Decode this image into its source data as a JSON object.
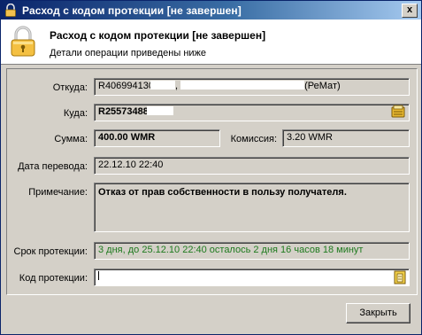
{
  "window": {
    "title": "Расход с кодом протекции [не завершен]",
    "close_glyph": "x"
  },
  "header": {
    "title": "Расход с кодом протекции [не завершен]",
    "subtitle": "Детали операции приведены ниже"
  },
  "form": {
    "from_label": "Откуда:",
    "from_purse": "R406994130",
    "from_sep": ",",
    "from_suffix": "(РеМат)",
    "to_label": "Куда:",
    "to_purse": "R25573488",
    "amount_label": "Сумма:",
    "amount_value": "400.00 WMR",
    "fee_label": "Комиссия:",
    "fee_value": "3.20 WMR",
    "date_label": "Дата перевода:",
    "date_value": "22.12.10 22:40",
    "note_label": "Примечание:",
    "note_value": "Отказ от прав собственности в пользу получателя.",
    "protection_term_label": "Срок протекции:",
    "protection_term_value": "3 дня, до 25.12.10 22:40 осталось 2 дня 16 часов 18 минут",
    "protection_code_label": "Код протекции:",
    "protection_code_value": ""
  },
  "buttons": {
    "close": "Закрыть"
  },
  "icons": {
    "title_icon": "lock-icon",
    "header_icon": "lock-icon",
    "to_picker": "wallet-icon",
    "code_picker": "notepad-icon"
  }
}
